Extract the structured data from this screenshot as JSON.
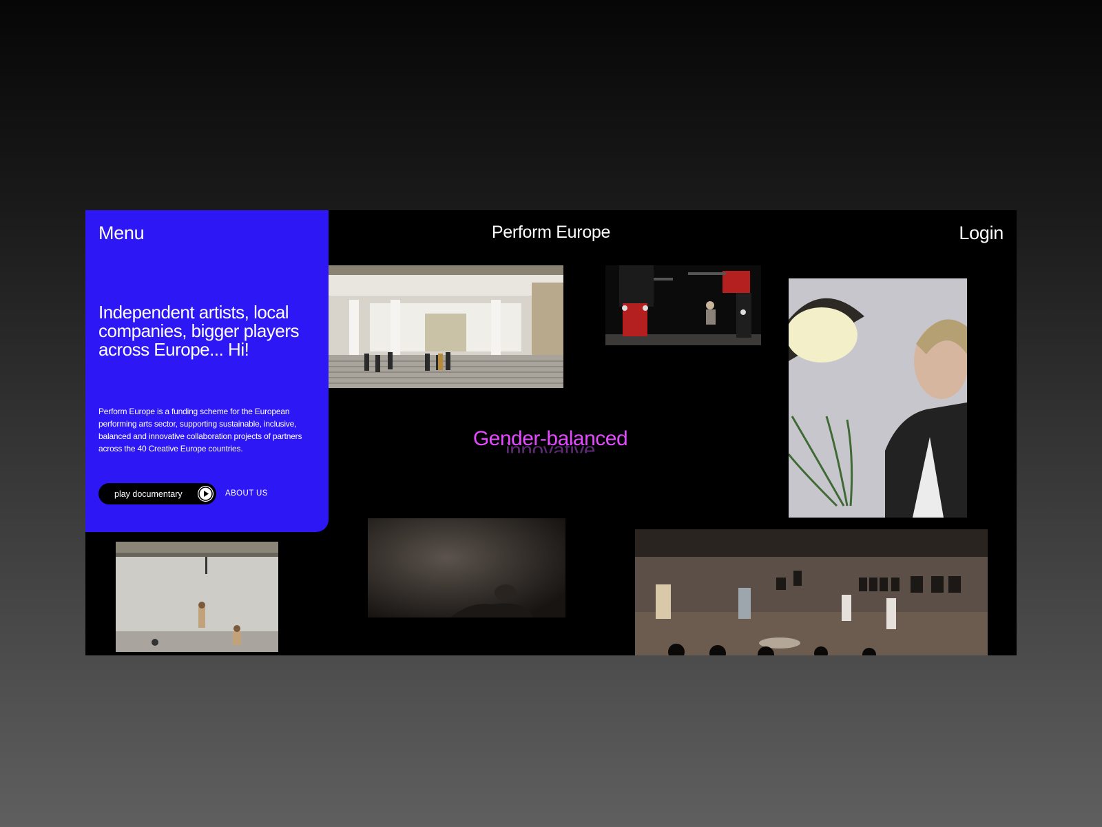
{
  "header": {
    "title": "Perform Europe",
    "login_label": "Login"
  },
  "panel": {
    "menu_label": "Menu",
    "headline": "Independent artists, local companies, bigger players across Europe... Hi!",
    "description": "Perform Europe is a funding scheme for the European performing arts sector, supporting sustainable, inclusive, balanced and innovative collaboration projects of partners across the 40 Creative Europe countries.",
    "play_label": "play documentary",
    "about_label": "ABOUT US",
    "accent_color": "#2d17f5"
  },
  "carousel": {
    "current_word": "Gender-balanced",
    "next_word": "innovative",
    "current_color": "#e44bff"
  },
  "icons": {
    "play": "play-icon"
  }
}
